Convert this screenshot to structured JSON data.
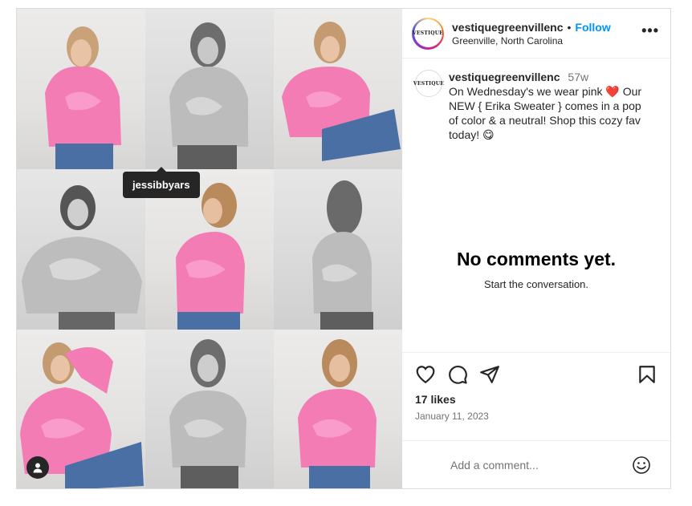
{
  "post": {
    "username": "vestiquegreenvillenc",
    "follow_label": "Follow",
    "dot": "•",
    "location": "Greenville, North Carolina",
    "more_label": "•••",
    "logo_text": "VESTIQUE"
  },
  "media": {
    "tag_username": "jessibbyars",
    "tiles": [
      "pink",
      "gray",
      "pink",
      "gray",
      "pink",
      "gray",
      "pink",
      "gray",
      "pink"
    ]
  },
  "caption": {
    "username": "vestiquegreenvillenc",
    "time": "57w",
    "text_part1": "On Wednesday's we wear pink ",
    "heart": "❤️",
    "text_part2": " Our NEW { Erika Sweater } comes in a pop of color & a neutral! Shop this cozy fav today! ",
    "emoji_end": "😋"
  },
  "comments": {
    "empty_title": "No comments yet.",
    "empty_subtitle": "Start the conversation."
  },
  "actions": {
    "likes": "17 likes",
    "date": "January 11, 2023"
  },
  "comment_box": {
    "placeholder": "Add a comment..."
  },
  "colors": {
    "sweater_pink": "#f47cb5",
    "sweater_gray": "#bdbdbd",
    "follow_blue": "#0095f6"
  }
}
